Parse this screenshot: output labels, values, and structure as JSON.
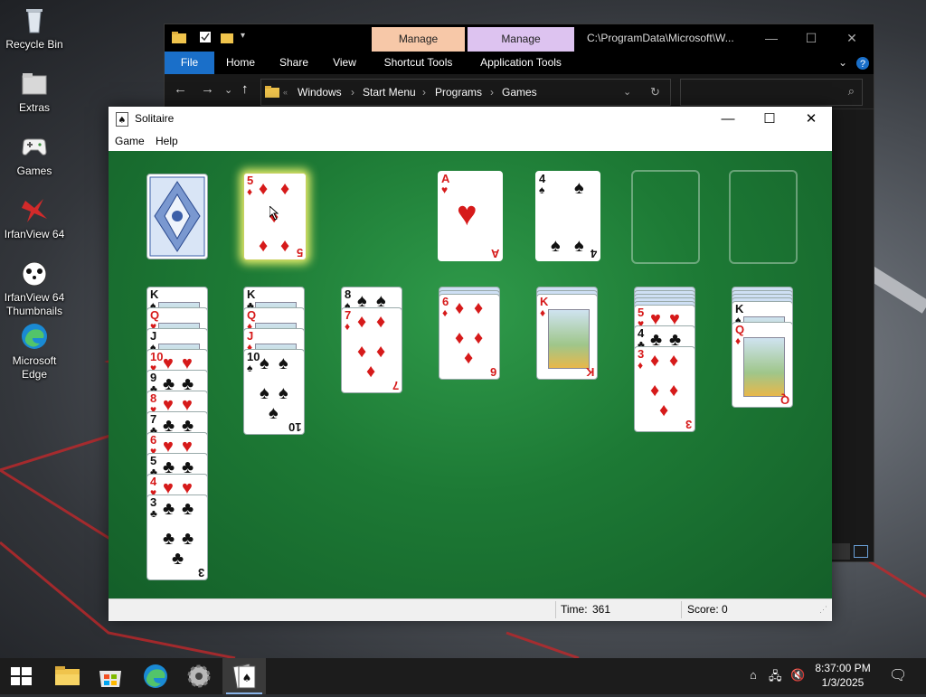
{
  "desktop": {
    "icons": [
      {
        "label": "Recycle Bin",
        "icon": "recycle-bin-icon"
      },
      {
        "label": "Extras",
        "icon": "folder-icon"
      },
      {
        "label": "Games",
        "icon": "gamepad-icon"
      },
      {
        "label": "IrfanView 64",
        "icon": "irfanview-icon"
      },
      {
        "label": "IrfanView 64 Thumbnails",
        "icon": "irfanview-thumbnails-icon"
      },
      {
        "label": "Microsoft Edge",
        "icon": "edge-icon"
      }
    ]
  },
  "explorer": {
    "context_tab_1": "Manage",
    "context_tab_2": "Manage",
    "title_path": "C:\\ProgramData\\Microsoft\\W...",
    "ribbon_tabs": [
      "File",
      "Home",
      "Share",
      "View",
      "Shortcut Tools",
      "Application Tools"
    ],
    "breadcrumbs": [
      "Windows",
      "Start Menu",
      "Programs",
      "Games"
    ],
    "colors": {
      "manage1": "#f7c8a8",
      "manage2": "#ddc3f0",
      "file_tab": "#1a6fc9"
    }
  },
  "solitaire": {
    "title": "Solitaire",
    "menu": [
      "Game",
      "Help"
    ],
    "status": {
      "time_label": "Time:",
      "time_value": "361",
      "score_label": "Score: 0"
    },
    "waste_card": {
      "rank": "5",
      "suit": "diamonds"
    },
    "foundations": [
      {
        "rank": "A",
        "suit": "hearts"
      },
      {
        "rank": "4",
        "suit": "spades"
      },
      {
        "empty": true
      },
      {
        "empty": true
      }
    ],
    "tableau": [
      {
        "face_down": 0,
        "face_up": [
          [
            "K",
            "spades"
          ],
          [
            "Q",
            "hearts"
          ],
          [
            "J",
            "spades"
          ],
          [
            "10",
            "hearts"
          ],
          [
            "9",
            "clubs"
          ],
          [
            "8",
            "hearts"
          ],
          [
            "7",
            "clubs"
          ],
          [
            "6",
            "hearts"
          ],
          [
            "5",
            "clubs"
          ],
          [
            "4",
            "hearts"
          ],
          [
            "3",
            "clubs"
          ]
        ]
      },
      {
        "face_down": 0,
        "face_up": [
          [
            "K",
            "clubs"
          ],
          [
            "Q",
            "diamonds"
          ],
          [
            "J",
            "diamonds"
          ],
          [
            "10",
            "spades"
          ]
        ]
      },
      {
        "face_down": 0,
        "face_up": [
          [
            "8",
            "spades"
          ],
          [
            "7",
            "diamonds"
          ]
        ]
      },
      {
        "face_down": 2,
        "face_up": [
          [
            "6",
            "diamonds"
          ]
        ]
      },
      {
        "face_down": 2,
        "face_up": [
          [
            "K",
            "diamonds"
          ]
        ]
      },
      {
        "face_down": 5,
        "face_up": [
          [
            "5",
            "hearts"
          ],
          [
            "4",
            "clubs"
          ],
          [
            "3",
            "diamonds"
          ]
        ]
      },
      {
        "face_down": 4,
        "face_up": [
          [
            "K",
            "spades"
          ],
          [
            "Q",
            "diamonds"
          ]
        ]
      }
    ],
    "colors": {
      "felt": "#1d7a35",
      "red_suit": "#d61a1a"
    }
  },
  "taskbar": {
    "items": [
      "start-icon",
      "file-explorer-icon",
      "store-icon",
      "edge-icon",
      "settings-icon",
      "solitaire-icon"
    ],
    "time": "8:37:00 PM",
    "date": "1/3/2025"
  }
}
